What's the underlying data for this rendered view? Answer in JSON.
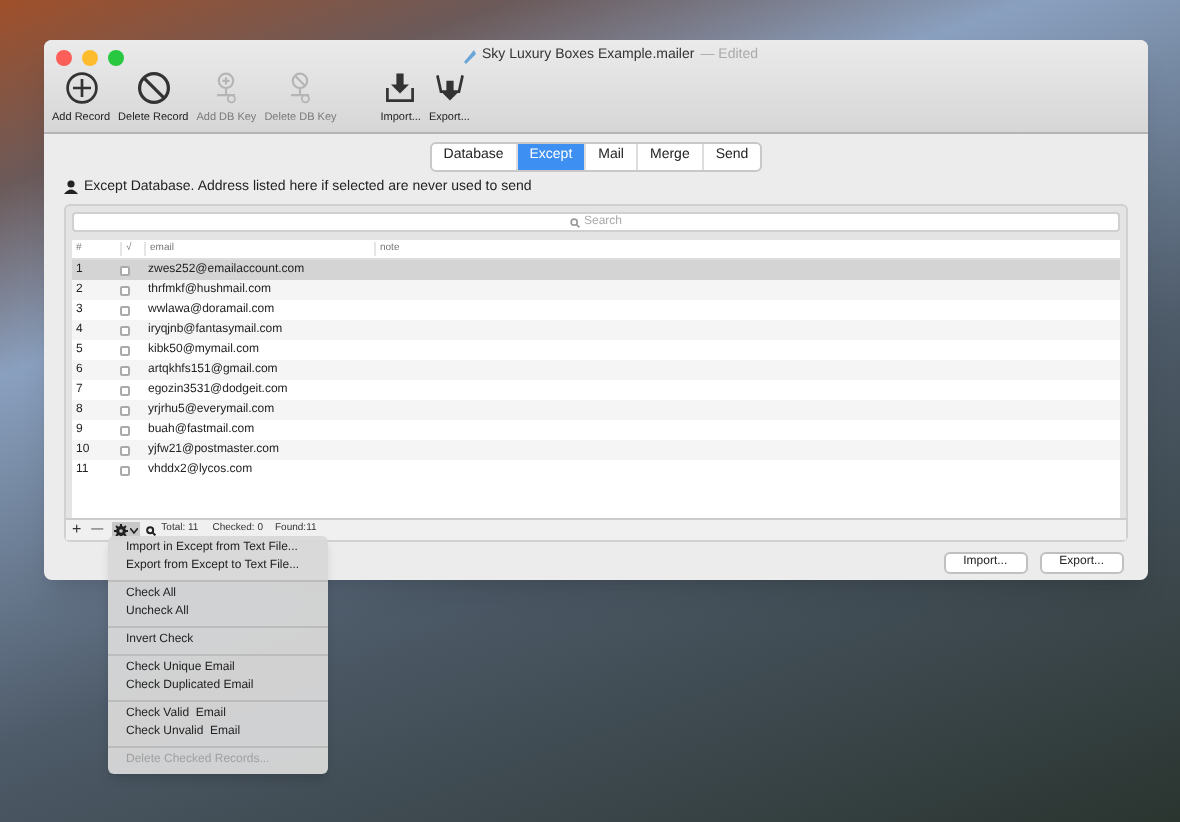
{
  "window": {
    "title": "Sky Luxury Boxes Example.mailer",
    "title_suffix": "— Edited"
  },
  "toolbar": [
    {
      "kind": "add",
      "label": "Add Record",
      "disabled": false
    },
    {
      "kind": "delete",
      "label": "Delete Record",
      "disabled": false
    },
    {
      "kind": "addkey",
      "label": "Add DB Key",
      "disabled": true
    },
    {
      "kind": "deletekey",
      "label": "Delete DB Key",
      "disabled": true
    },
    {
      "kind": "import",
      "label": "Import...",
      "disabled": false
    },
    {
      "kind": "export",
      "label": "Export...",
      "disabled": false
    }
  ],
  "tabs": [
    {
      "label": "Database",
      "selected": false
    },
    {
      "label": "Except",
      "selected": true
    },
    {
      "label": "Mail",
      "selected": false
    },
    {
      "label": "Merge",
      "selected": false
    },
    {
      "label": "Send",
      "selected": false
    }
  ],
  "description": "Except Database. Address listed here if selected are never used to send",
  "search": {
    "placeholder": "Search"
  },
  "table": {
    "columns": [
      "#",
      "√",
      "email",
      "note"
    ],
    "rows": [
      {
        "num": "1",
        "checked": false,
        "email": "zwes252@emailaccount.com",
        "selected": true
      },
      {
        "num": "2",
        "checked": false,
        "email": "thrfmkf@hushmail.com",
        "selected": false
      },
      {
        "num": "3",
        "checked": false,
        "email": "wwlawa@doramail.com",
        "selected": false
      },
      {
        "num": "4",
        "checked": false,
        "email": "iryqjnb@fantasymail.com",
        "selected": false
      },
      {
        "num": "5",
        "checked": false,
        "email": "kibk50@mymail.com",
        "selected": false
      },
      {
        "num": "6",
        "checked": false,
        "email": "artqkhfs151@gmail.com",
        "selected": false
      },
      {
        "num": "7",
        "checked": false,
        "email": "egozin3531@dodgeit.com",
        "selected": false
      },
      {
        "num": "8",
        "checked": false,
        "email": "yrjrhu5@everymail.com",
        "selected": false
      },
      {
        "num": "9",
        "checked": false,
        "email": "buah@fastmail.com",
        "selected": false
      },
      {
        "num": "10",
        "checked": false,
        "email": "yjfw21@postmaster.com",
        "selected": false
      },
      {
        "num": "11",
        "checked": false,
        "email": "vhddx2@lycos.com",
        "selected": false
      }
    ]
  },
  "status_bar": {
    "add": "+",
    "remove": "—",
    "total": "Total: 11",
    "checked": "Checked: 0",
    "found": "Found:11"
  },
  "buttons": [
    "Import...",
    "Export..."
  ],
  "menu": [
    [
      {
        "label": "Import in Except from Text File...",
        "disabled": false
      },
      {
        "label": "Export from Except to Text File...",
        "disabled": false
      }
    ],
    [
      {
        "label": "Check All",
        "disabled": false
      },
      {
        "label": "Uncheck All",
        "disabled": false
      }
    ],
    [
      {
        "label": "Invert Check",
        "disabled": false
      }
    ],
    [
      {
        "label": "Check Unique Email",
        "disabled": false
      },
      {
        "label": "Check Duplicated Email",
        "disabled": false
      }
    ],
    [
      {
        "label": "Check Valid  Email",
        "disabled": false
      },
      {
        "label": "Check Unvalid  Email",
        "disabled": false
      }
    ],
    [
      {
        "label": "Delete Checked Records...",
        "disabled": true
      }
    ]
  ]
}
